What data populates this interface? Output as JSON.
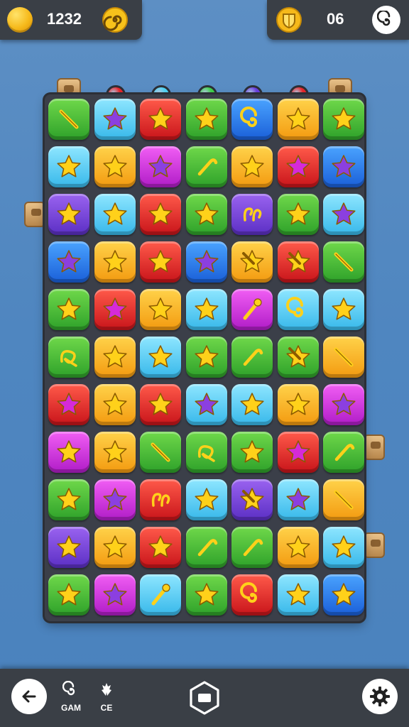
{
  "hud": {
    "coins": "1232",
    "moves": "06"
  },
  "bottom_nav": {
    "game_label": "GAM",
    "ce_label": "CE"
  },
  "colors": {
    "green": "#2ea12a",
    "cyan": "#37b8ea",
    "red": "#c8141a",
    "orange": "#f39a10",
    "magenta": "#b01cc7",
    "purple": "#5b2fc4",
    "blue": "#1a5fd8",
    "star": "#ffd11a"
  },
  "column_gems": [
    "red",
    "cyan",
    "green",
    "purple",
    "red"
  ],
  "board": [
    [
      [
        "green",
        "stick"
      ],
      [
        "cyan",
        "star-purple"
      ],
      [
        "red",
        "star"
      ],
      [
        "green",
        "star"
      ],
      [
        "blue",
        "swirl"
      ],
      [
        "orange",
        "star"
      ],
      [
        "green",
        "star"
      ]
    ],
    [
      [
        "cyan",
        "star"
      ],
      [
        "orange",
        "star"
      ],
      [
        "magenta",
        "star-purple"
      ],
      [
        "green",
        "cane"
      ],
      [
        "orange",
        "star"
      ],
      [
        "red",
        "star-magenta"
      ],
      [
        "blue",
        "star-purple"
      ]
    ],
    [
      [
        "purple",
        "star"
      ],
      [
        "cyan",
        "star"
      ],
      [
        "red",
        "star"
      ],
      [
        "green",
        "star"
      ],
      [
        "purple",
        "curl"
      ],
      [
        "green",
        "star"
      ],
      [
        "cyan",
        "star-purple"
      ]
    ],
    [
      [
        "blue",
        "star-purple"
      ],
      [
        "orange",
        "star"
      ],
      [
        "red",
        "star"
      ],
      [
        "blue",
        "star-purple"
      ],
      [
        "orange",
        "star-wand"
      ],
      [
        "red",
        "star-wand"
      ],
      [
        "green",
        "stick"
      ]
    ],
    [
      [
        "green",
        "star"
      ],
      [
        "red",
        "star-magenta"
      ],
      [
        "orange",
        "star"
      ],
      [
        "cyan",
        "star"
      ],
      [
        "magenta",
        "wand"
      ],
      [
        "cyan",
        "swirl"
      ],
      [
        "cyan",
        "star"
      ]
    ],
    [
      [
        "green",
        "knot"
      ],
      [
        "orange",
        "star"
      ],
      [
        "cyan",
        "star"
      ],
      [
        "green",
        "star"
      ],
      [
        "green",
        "cane"
      ],
      [
        "green",
        "star-wand"
      ],
      [
        "orange",
        "stick"
      ]
    ],
    [
      [
        "red",
        "star-magenta"
      ],
      [
        "orange",
        "star"
      ],
      [
        "red",
        "star"
      ],
      [
        "cyan",
        "star-purple"
      ],
      [
        "cyan",
        "star"
      ],
      [
        "orange",
        "star"
      ],
      [
        "magenta",
        "star-purple"
      ]
    ],
    [
      [
        "magenta",
        "star"
      ],
      [
        "orange",
        "star"
      ],
      [
        "green",
        "stick"
      ],
      [
        "green",
        "knot"
      ],
      [
        "green",
        "star"
      ],
      [
        "red",
        "star-magenta"
      ],
      [
        "green",
        "cane"
      ]
    ],
    [
      [
        "green",
        "star"
      ],
      [
        "magenta",
        "star-purple"
      ],
      [
        "red",
        "curl"
      ],
      [
        "cyan",
        "star"
      ],
      [
        "purple",
        "star-wand"
      ],
      [
        "cyan",
        "star-purple"
      ],
      [
        "orange",
        "stick"
      ]
    ],
    [
      [
        "purple",
        "star"
      ],
      [
        "orange",
        "star"
      ],
      [
        "red",
        "star"
      ],
      [
        "green",
        "cane"
      ],
      [
        "green",
        "cane"
      ],
      [
        "orange",
        "star"
      ],
      [
        "cyan",
        "star"
      ]
    ],
    [
      [
        "green",
        "star"
      ],
      [
        "magenta",
        "star-purple"
      ],
      [
        "cyan",
        "wand"
      ],
      [
        "green",
        "star"
      ],
      [
        "red",
        "swirl"
      ],
      [
        "cyan",
        "star"
      ],
      [
        "blue",
        "star"
      ]
    ]
  ]
}
